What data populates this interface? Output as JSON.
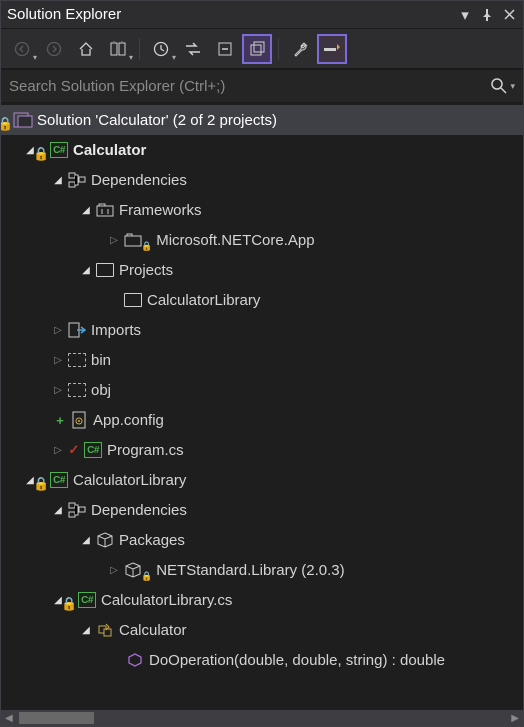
{
  "title": "Solution Explorer",
  "search": {
    "placeholder": "Search Solution Explorer (Ctrl+;)"
  },
  "tree": {
    "solution": "Solution 'Calculator' (2 of 2 projects)",
    "proj1": {
      "name": "Calculator",
      "dependencies": "Dependencies",
      "frameworks": "Frameworks",
      "netcore": "Microsoft.NETCore.App",
      "projects": "Projects",
      "projref": "CalculatorLibrary",
      "imports": "Imports",
      "bin": "bin",
      "obj": "obj",
      "appconfig": "App.config",
      "program": "Program.cs"
    },
    "proj2": {
      "name": "CalculatorLibrary",
      "dependencies": "Dependencies",
      "packages": "Packages",
      "netstd": "NETStandard.Library (2.0.3)",
      "file": "CalculatorLibrary.cs",
      "class": "Calculator",
      "method": "DoOperation(double, double, string) : double"
    }
  }
}
